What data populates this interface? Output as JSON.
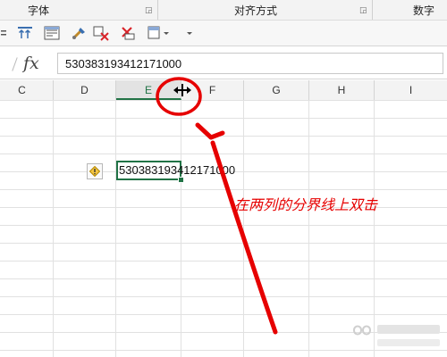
{
  "ribbon": {
    "groups": {
      "font": "字体",
      "alignment": "对齐方式",
      "number": "数字"
    }
  },
  "formula_bar": {
    "fx_label": "fx",
    "value": "530383193412171000"
  },
  "columns": [
    "C",
    "D",
    "E",
    "F",
    "G",
    "H",
    "I"
  ],
  "selected_column": "E",
  "cell": {
    "value": "530383193412171000"
  },
  "annotation": "在两列的分界线上双击",
  "colors": {
    "accent": "#217346",
    "annotation": "#e60000"
  },
  "icons": [
    "align-top-icon",
    "wrap-text-icon",
    "format-painter-icon",
    "clear-icon",
    "delete-icon",
    "cell-style-icon",
    "dropdown-icon",
    "warning-icon",
    "resize-cursor-icon"
  ]
}
